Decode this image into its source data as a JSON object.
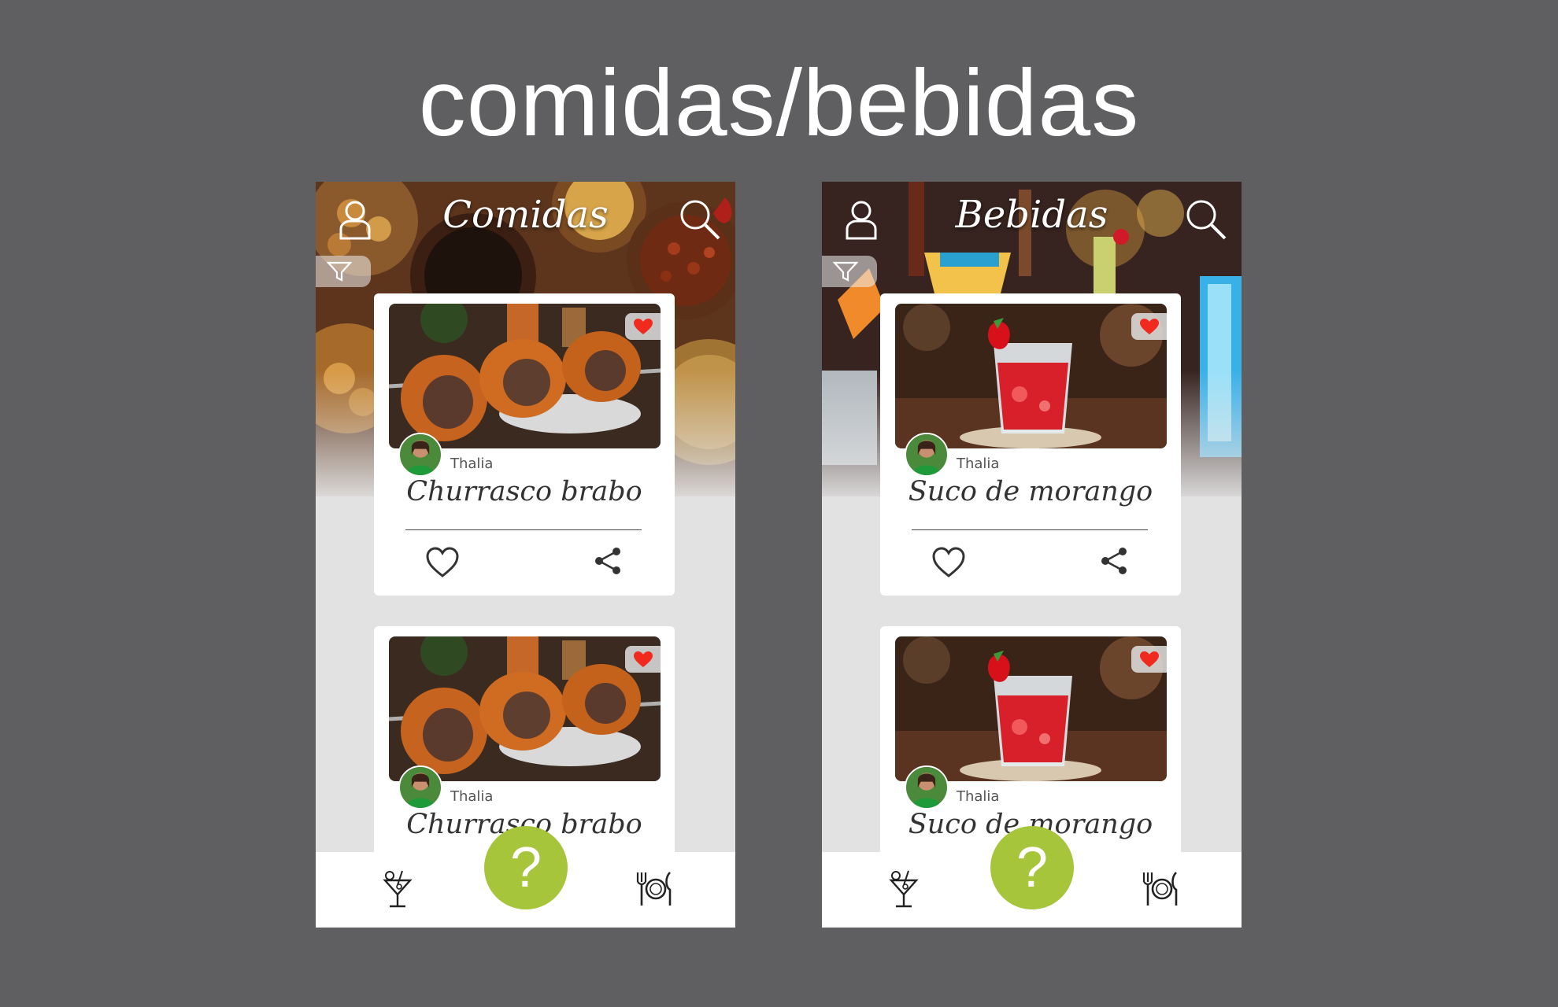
{
  "heading": "comidas/bebidas",
  "colors": {
    "background": "#5f5f61",
    "accent": "#a7c53b",
    "favorite": "#f02a1f"
  },
  "screens": [
    {
      "title": "Comidas",
      "icons": {
        "user": "user-icon",
        "search": "search-icon",
        "filter": "filter-icon"
      },
      "cards": [
        {
          "author": "Thalia",
          "dish": "Churrasco brabo",
          "favorited": true
        },
        {
          "author": "Thalia",
          "dish": "Churrasco brabo",
          "favorited": true
        }
      ],
      "bottom_nav": {
        "left": "drinks-icon",
        "center": "?",
        "right": "food-icon"
      }
    },
    {
      "title": "Bebidas",
      "icons": {
        "user": "user-icon",
        "search": "search-icon",
        "filter": "filter-icon"
      },
      "cards": [
        {
          "author": "Thalia",
          "dish": "Suco de morango",
          "favorited": true
        },
        {
          "author": "Thalia",
          "dish": "Suco de morango",
          "favorited": true
        }
      ],
      "bottom_nav": {
        "left": "drinks-icon",
        "center": "?",
        "right": "food-icon"
      }
    }
  ]
}
